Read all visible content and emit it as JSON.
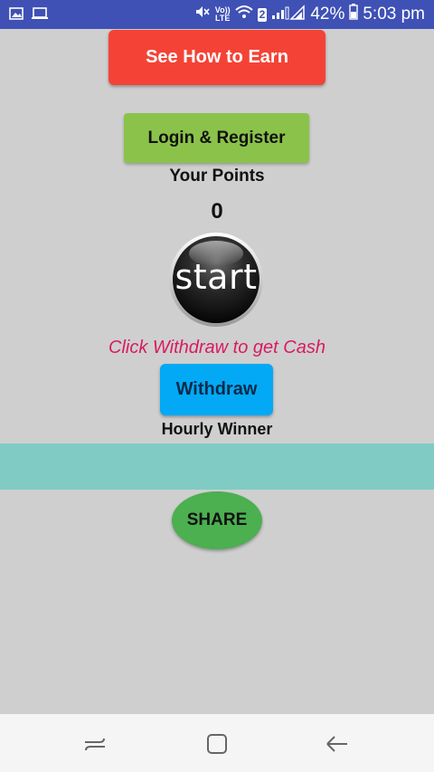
{
  "status_bar": {
    "network_label_top": "Vo))",
    "network_label_bottom": "LTE",
    "sim_slot": "2",
    "battery_percent": "42%",
    "time": "5:03 pm"
  },
  "main": {
    "earn_button_label": "See How to Earn",
    "login_button_label": "Login & Register",
    "points_label": "Your Points",
    "points_value": "0",
    "start_button_label": "start",
    "withdraw_hint": "Click Withdraw to get Cash",
    "withdraw_button_label": "Withdraw",
    "hourly_winner_label": "Hourly Winner",
    "share_button_label": "SHARE"
  },
  "colors": {
    "status_bar": "#3f51b5",
    "background": "#cfcfcf",
    "earn_button": "#f44336",
    "login_button": "#8bc34a",
    "withdraw_button": "#03a9f4",
    "share_button": "#4caf50",
    "hint_text": "#d81b60",
    "band": "#80cbc4"
  },
  "icons": [
    "image-icon",
    "laptop-icon",
    "mute-icon",
    "wifi-icon",
    "signal-icon",
    "battery-icon",
    "recent-apps-icon",
    "home-icon",
    "back-icon"
  ]
}
